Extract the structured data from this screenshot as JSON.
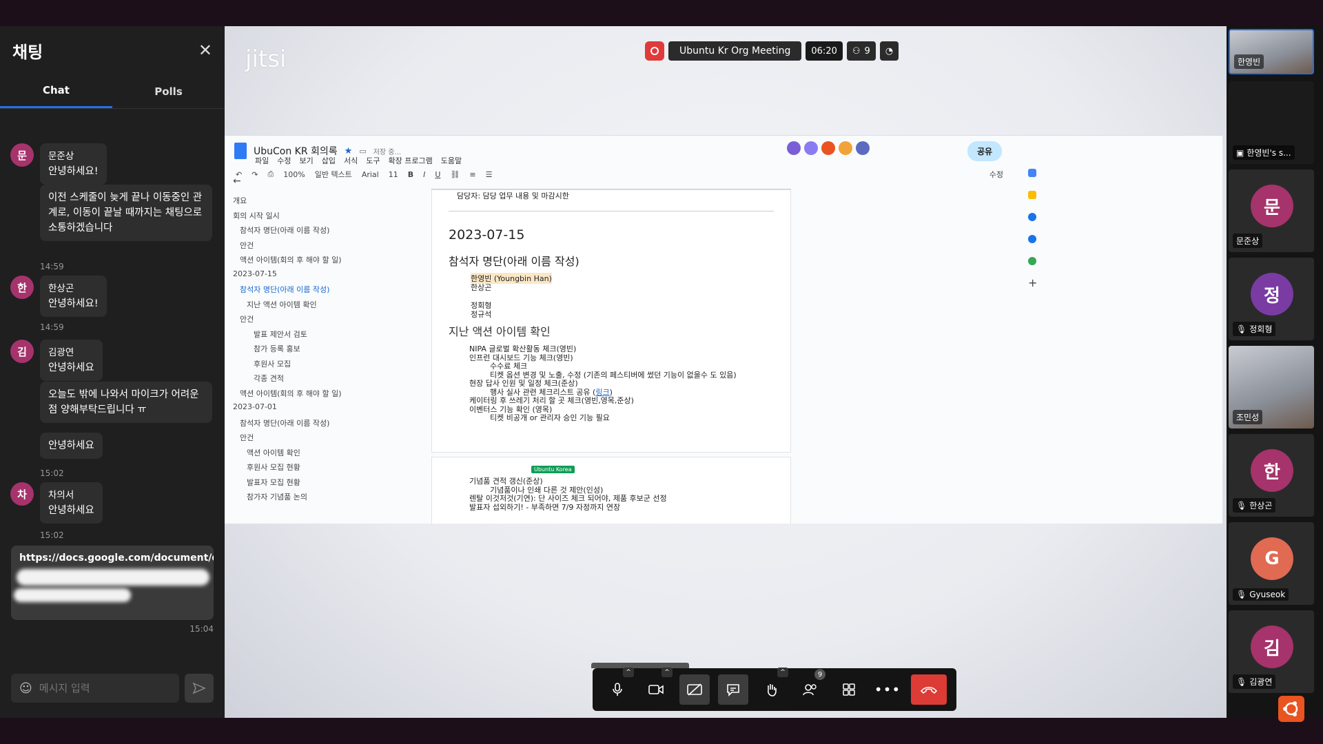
{
  "chat": {
    "title": "채팅",
    "tabs": [
      "Chat",
      "Polls"
    ],
    "messages": [
      {
        "initial": "문",
        "sender": "문준상",
        "text": "안녕하세요!"
      },
      {
        "text": "이전 스케줄이 늦게 끝나 이동중인 관계로, 이동이 끝날 때까지는 채팅으로 소통하겠습니다",
        "time": "14:59"
      },
      {
        "initial": "한",
        "sender": "한상곤",
        "text": "안녕하세요!",
        "time": "14:59"
      },
      {
        "initial": "김",
        "sender": "김광연",
        "text": "안녕하세요"
      },
      {
        "text": "오늘도 밖에 나와서 마이크가 어려운 점 양해부탁드립니다 ㅠ"
      },
      {
        "text": "안녕하세요",
        "time": "15:02"
      },
      {
        "initial": "차",
        "sender": "차의서",
        "text": "안녕하세요",
        "time": "15:02"
      }
    ],
    "own_link": "https://docs.google.com/document/d/1",
    "own_time": "15:04",
    "input_placeholder": "메시지 입력"
  },
  "stage": {
    "logo": "jitsi",
    "meeting_name": "Ubuntu Kr Org Meeting",
    "timer": "06:20",
    "participant_count": "9"
  },
  "docs": {
    "title": "UbuCon KR 회의록",
    "save_status": "저장 중...",
    "menu": [
      "파일",
      "수정",
      "보기",
      "삽입",
      "서식",
      "도구",
      "확장 프로그램",
      "도움말"
    ],
    "toolbar": [
      "100%",
      "일반 텍스트",
      "Arial",
      "11",
      "수정"
    ],
    "share": "공유",
    "outline": [
      {
        "t": "개요",
        "lvl": 0
      },
      {
        "t": "회의 시작 일시",
        "lvl": 0
      },
      {
        "t": "참석자 명단(아래 이름 작성)",
        "lvl": 1
      },
      {
        "t": "안건",
        "lvl": 1
      },
      {
        "t": "액션 아이템(회의 후 해야 할 일)",
        "lvl": 1
      },
      {
        "t": "2023-07-15",
        "lvl": 0
      },
      {
        "t": "참석자 명단(아래 이름 작성)",
        "lvl": 1,
        "sel": true
      },
      {
        "t": "지난 액션 아이템 확인",
        "lvl": 2
      },
      {
        "t": "안건",
        "lvl": 1
      },
      {
        "t": "발표 제안서 검토",
        "lvl": 3
      },
      {
        "t": "참가 등록 홍보",
        "lvl": 3
      },
      {
        "t": "후원사 모집",
        "lvl": 3
      },
      {
        "t": "각종 견적",
        "lvl": 3
      },
      {
        "t": "액션 아이템(회의 후 해야 할 일)",
        "lvl": 1
      },
      {
        "t": "2023-07-01",
        "lvl": 0
      },
      {
        "t": "참석자 명단(아래 이름 작성)",
        "lvl": 1
      },
      {
        "t": "안건",
        "lvl": 1
      },
      {
        "t": "액션 아이템 확인",
        "lvl": 2
      },
      {
        "t": "후원사 모집 현황",
        "lvl": 2
      },
      {
        "t": "발표자 모집 현황",
        "lvl": 2
      },
      {
        "t": "참가자 기념품 논의",
        "lvl": 2
      }
    ],
    "page": {
      "top_line": "담당자: 담당 업무 내용 및 마감시한",
      "date": "2023-07-15",
      "attendees_heading": "참석자 명단(아래 이름 작성)",
      "attendees": [
        "한영빈 (Youngbin Han)",
        "한상곤",
        "",
        "정회형",
        "정규석"
      ],
      "actions_heading": "지난 액션 아이템 확인",
      "actions": [
        {
          "t": "NIPA 글로벌 확산활동 체크(영빈)",
          "lvl": 0
        },
        {
          "t": "인프런 대시보드 기능 체크(영빈)",
          "lvl": 0
        },
        {
          "t": "수수료 체크",
          "lvl": 1
        },
        {
          "t": "티켓 옵션 변경 및 노출, 수정 (기존의 페스티버에 썼던 기능이 없을수 도 있음)",
          "lvl": 1
        },
        {
          "t": "현장 답사 인원 및 일정 체크(준상)",
          "lvl": 0
        },
        {
          "t": "행사 실사 관련 체크리스트 공유 (",
          "link": "링크",
          "tail": ")",
          "lvl": 1
        },
        {
          "t": "케이터링 후 쓰레기 처리 할 곳 체크(영빈,영목,준상)",
          "lvl": 0
        },
        {
          "t": "이벤터스 기능 확인 (영목)",
          "lvl": 0
        },
        {
          "t": "티켓 비공개 or 관리자 승인 기능 필요",
          "lvl": 1
        }
      ],
      "page2_tag": "Ubuntu Korea",
      "page2": [
        {
          "t": "기념품 견적 갱신(준상)",
          "lvl": 0
        },
        {
          "t": "기념품이나 인쇄 다른 것 제안(인성)",
          "lvl": 1
        },
        {
          "t": "렌탈 이것저것(기연): 단 사이즈 체크 되어야, 제품 후보군 선정",
          "lvl": 0
        },
        {
          "t": "발표자 섭외하기! - 부족하면 7/9 자정까지 연장",
          "lvl": 0
        }
      ]
    }
  },
  "participants": [
    {
      "name": "한영빈",
      "type": "camera"
    },
    {
      "name": "한영빈's s...",
      "type": "screen"
    },
    {
      "name": "문준상",
      "initial": "문",
      "color": "#a6336b"
    },
    {
      "name": "정회형",
      "initial": "정",
      "color": "#7a3ba3"
    },
    {
      "name": "조민성",
      "type": "camera"
    },
    {
      "name": "한상곤",
      "initial": "한",
      "color": "#a6336b"
    },
    {
      "name": "Gyuseok",
      "initial": "G",
      "color": "#e06a52"
    },
    {
      "name": "김광연",
      "initial": "김",
      "color": "#a6336b"
    }
  ],
  "toolbar": {
    "participants_badge": "9"
  }
}
